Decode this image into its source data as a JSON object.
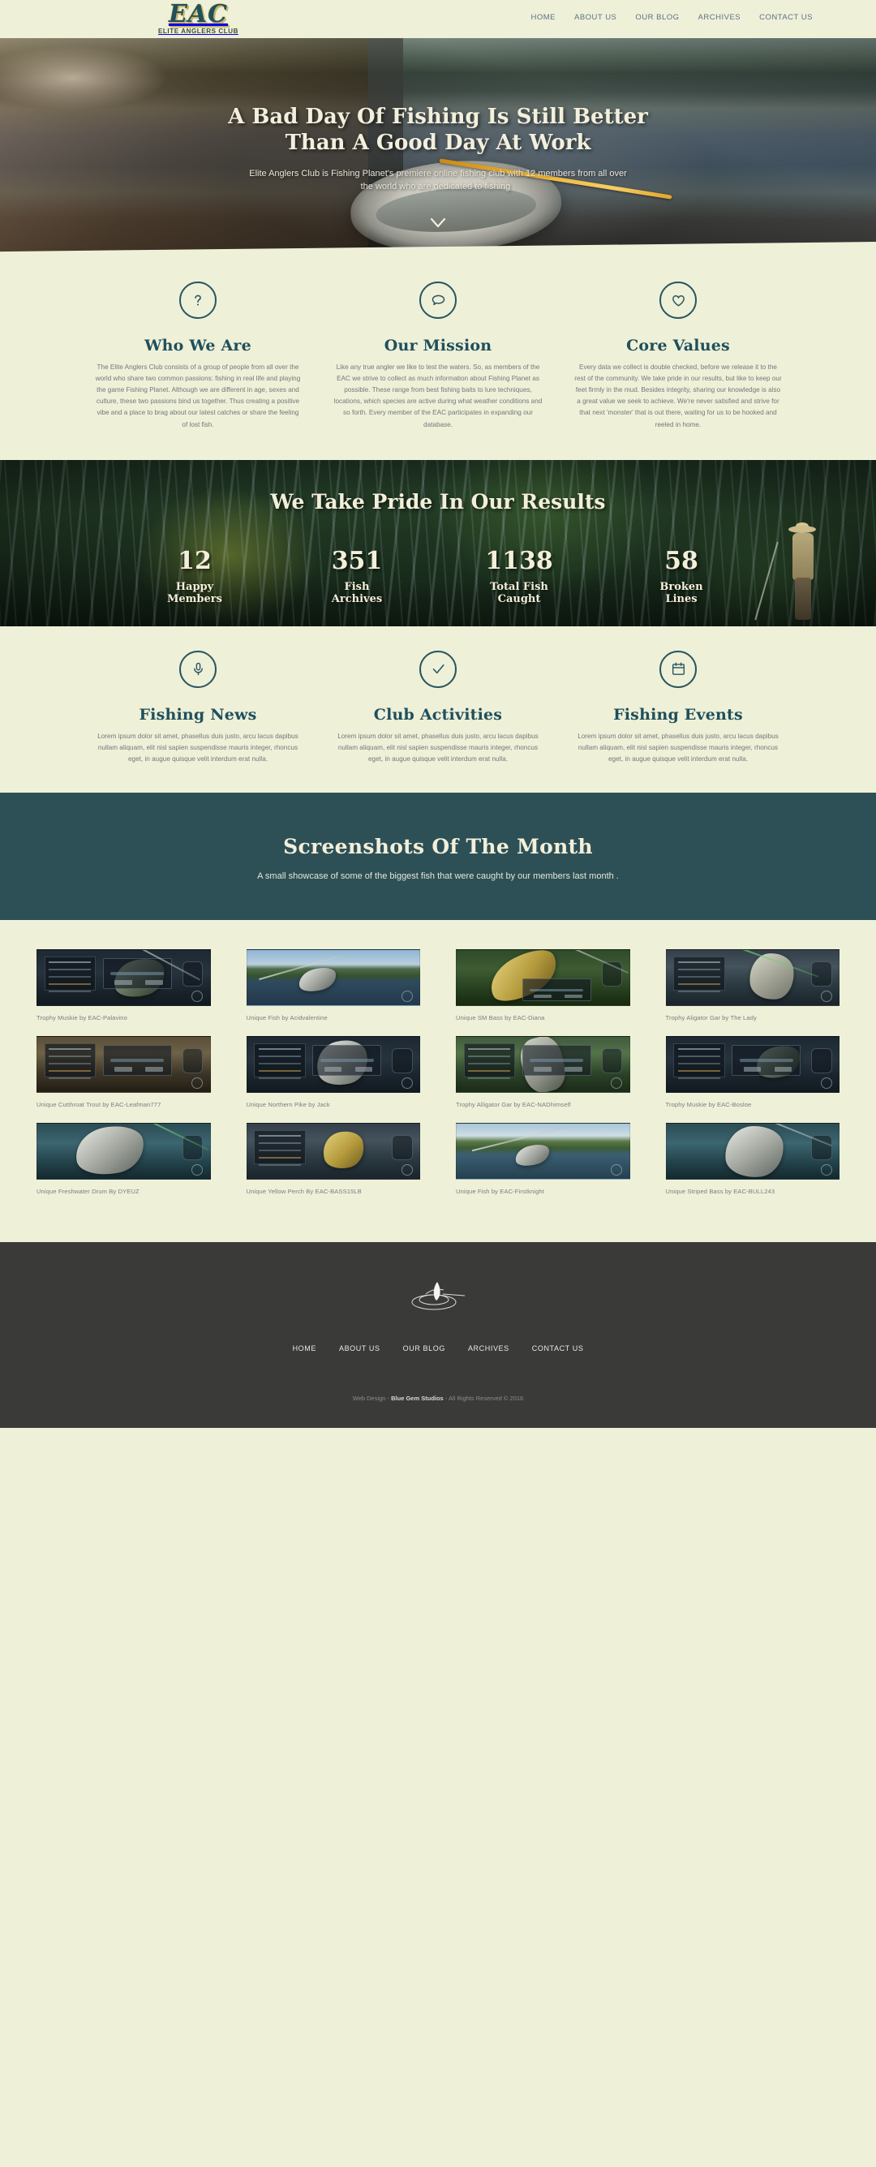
{
  "header": {
    "logo_mark": "EAC",
    "logo_sub": "ELITE ANGLERS CLUB",
    "nav": [
      {
        "label": "HOME"
      },
      {
        "label": "ABOUT US"
      },
      {
        "label": "OUR BLOG"
      },
      {
        "label": "ARCHIVES"
      },
      {
        "label": "CONTACT US"
      }
    ]
  },
  "hero": {
    "title_line1": "A Bad Day Of Fishing Is Still Better",
    "title_line2": "Than A Good Day At Work",
    "subtitle": "Elite Anglers Club is Fishing Planet's premiere online fishing club with 12 members from all over the world who are dedicated to fishing .",
    "scroll_icon": "chevron-down-icon"
  },
  "features": [
    {
      "icon": "question-mark-icon",
      "title": "Who We Are",
      "body": "The Elite Anglers Club consists of a group of people from all over the world who share two common passions: fishing in real life and playing the game Fishing Planet. Although we are different in age, sexes and culture, these two passions bind us together. Thus creating a positive vibe and a place to brag about our latest catches or share the feeling of lost fish."
    },
    {
      "icon": "speech-bubble-icon",
      "title": "Our Mission",
      "body": "Like any true angler we like to test the waters. So, as members of the EAC we strive to collect as much information about Fishing Planet as possible. These range from best fishing baits to lure techniques, locations, which species are active during what weather conditions and so forth. Every member of the EAC participates in expanding our database."
    },
    {
      "icon": "heart-icon",
      "title": "Core Values",
      "body": "Every data we collect is double checked, before we release it to the rest of the community. We take pride in our results, but like to keep our feet firmly in the mud. Besides integrity, sharing our knowledge is also a great value we seek to achieve. We're never satisfied and strive for that next 'monster' that is out there, waiting for us to be hooked and reeled in home."
    }
  ],
  "results": {
    "title": "We Take Pride In Our Results",
    "stats": [
      {
        "value": "12",
        "label_line1": "Happy",
        "label_line2": "Members"
      },
      {
        "value": "351",
        "label_line1": "Fish",
        "label_line2": "Archives"
      },
      {
        "value": "1138",
        "label_line1": "Total Fish",
        "label_line2": "Caught"
      },
      {
        "value": "58",
        "label_line1": "Broken",
        "label_line2": "Lines"
      }
    ]
  },
  "services": [
    {
      "icon": "microphone-icon",
      "title": "Fishing News",
      "body": "Lorem ipsum dolor sit amet, phasellus duis justo, arcu lacus dapibus nullam aliquam, elit nisl sapien suspendisse mauris integer, rhoncus eget, in augue quisque velit interdum erat nulla."
    },
    {
      "icon": "checkmark-icon",
      "title": "Club Activities",
      "body": "Lorem ipsum dolor sit amet, phasellus duis justo, arcu lacus dapibus nullam aliquam, elit nisl sapien suspendisse mauris integer, rhoncus eget, in augue quisque velit interdum erat nulla."
    },
    {
      "icon": "calendar-icon",
      "title": "Fishing Events",
      "body": "Lorem ipsum dolor sit amet, phasellus duis justo, arcu lacus dapibus nullam aliquam, elit nisl sapien suspendisse mauris integer, rhoncus eget, in augue quisque velit interdum erat nulla."
    }
  ],
  "banner": {
    "title": "Screenshots Of The Month",
    "subtitle": "A small showcase of some of the biggest fish that were caught by our members last month ."
  },
  "gallery": [
    {
      "caption": "Trophy Muskie by EAC-Palavino"
    },
    {
      "caption": "Unique Fish by Acidvalentine"
    },
    {
      "caption": "Unique SM Bass by EAC-Diana"
    },
    {
      "caption": "Trophy Aligator Gar by The Lady"
    },
    {
      "caption": "Unique Cutthroat Trout by EAC-Leafman777"
    },
    {
      "caption": "Unique Northern Pike by Jack"
    },
    {
      "caption": "Trophy Alligator Gar by EAC-NADhimself"
    },
    {
      "caption": "Trophy Muskie by EAC-Bosloe"
    },
    {
      "caption": "Unique Freshwater Drum By DYEUZ"
    },
    {
      "caption": "Unique Yellow Perch By EAC-BASS15LB"
    },
    {
      "caption": "Unique Fish by EAC-Firstknight"
    },
    {
      "caption": "Unique Striped Bass by EAC-BULL243"
    }
  ],
  "footer": {
    "logo_icon": "fish-jump-ripple-icon",
    "nav": [
      {
        "label": "HOME"
      },
      {
        "label": "ABOUT US"
      },
      {
        "label": "OUR BLOG"
      },
      {
        "label": "ARCHIVES"
      },
      {
        "label": "CONTACT US"
      }
    ],
    "credit_prefix": "Web Design - ",
    "credit_brand": "Blue Gem Studios",
    "credit_suffix": " - All Rights Reserved © 2016"
  },
  "colors": {
    "page_bg": "#eef0d8",
    "accent_teal": "#1f4f5c",
    "banner_bg": "#2d5057",
    "footer_bg": "#3a3a38",
    "nav_link": "#5d7288",
    "body_text": "#74787a"
  }
}
